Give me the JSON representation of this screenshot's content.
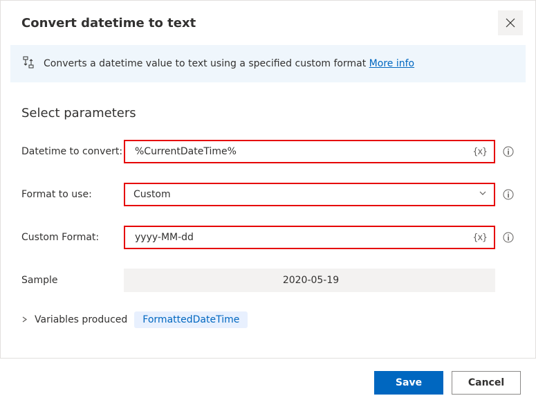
{
  "header": {
    "title": "Convert datetime to text"
  },
  "info": {
    "text": "Converts a datetime value to text using a specified custom format ",
    "more_label": "More info"
  },
  "section": {
    "title": "Select parameters"
  },
  "fields": {
    "datetime": {
      "label": "Datetime to convert:",
      "value": "%CurrentDateTime%"
    },
    "format": {
      "label": "Format to use:",
      "value": "Custom"
    },
    "custom": {
      "label": "Custom Format:",
      "value": "yyyy-MM-dd"
    },
    "sample": {
      "label": "Sample",
      "value": "2020-05-19"
    }
  },
  "vars": {
    "label": "Variables produced",
    "chip": "FormattedDateTime"
  },
  "footer": {
    "save": "Save",
    "cancel": "Cancel"
  }
}
